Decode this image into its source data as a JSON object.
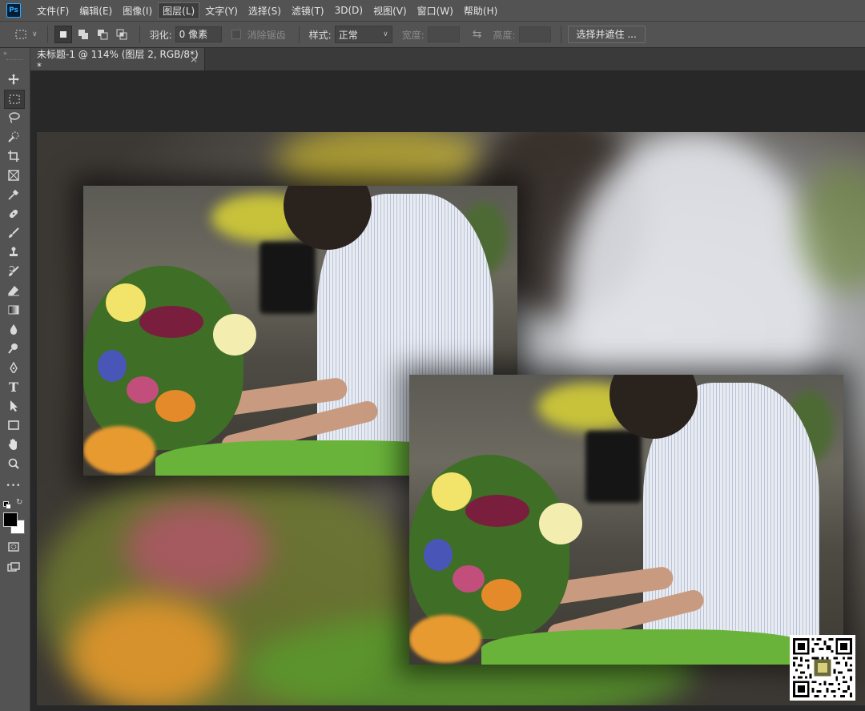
{
  "app": {
    "logo_text": "Ps"
  },
  "menu": [
    "文件(F)",
    "编辑(E)",
    "图像(I)",
    "图层(L)",
    "文字(Y)",
    "选择(S)",
    "滤镜(T)",
    "3D(D)",
    "视图(V)",
    "窗口(W)",
    "帮助(H)"
  ],
  "options": {
    "feather_label": "羽化:",
    "feather_value": "0 像素",
    "antialias_label": "消除锯齿",
    "style_label": "样式:",
    "style_value": "正常",
    "width_label": "宽度:",
    "height_label": "高度:",
    "select_mask_button": "选择并遮住 ..."
  },
  "document": {
    "tab_title": "未标题-1 @ 114% (图层 2, RGB/8*) *",
    "close_symbol": "×"
  },
  "colors": {
    "ui_bg": "#535353",
    "workspace_bg": "#282828",
    "ps_blue": "#31a8ff"
  },
  "tools": [
    "move-icon",
    "rect-marquee-icon",
    "lasso-icon",
    "quick-select-icon",
    "crop-icon",
    "frame-icon",
    "eyedropper-icon",
    "healing-brush-icon",
    "brush-icon",
    "stamp-icon",
    "history-brush-icon",
    "eraser-icon",
    "gradient-icon",
    "blur-icon",
    "dodge-icon",
    "pen-icon",
    "type-icon",
    "path-select-icon",
    "rectangle-icon",
    "hand-icon",
    "zoom-icon",
    "more-icon"
  ],
  "tool_labels": {
    "type_glyph": "T",
    "more_glyph": "•••"
  }
}
